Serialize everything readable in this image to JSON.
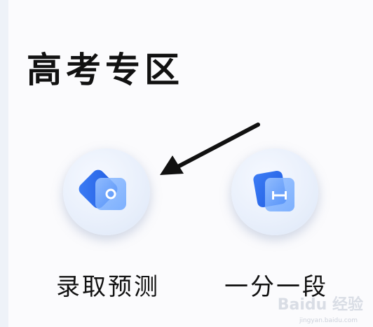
{
  "section": {
    "title": "高考专区"
  },
  "features": [
    {
      "label": "录取预测",
      "icon": "admission-prediction-icon"
    },
    {
      "label": "一分一段",
      "icon": "score-segment-icon"
    }
  ],
  "annotation": {
    "arrow": "arrow-pointing-left"
  },
  "watermark": {
    "text": "Baidu 经验",
    "sub": "jingyan.baidu.com"
  },
  "colors": {
    "accent_blue": "#2f6cf0",
    "accent_blue_light": "#5a9bff",
    "circle_bg": "#e8effb",
    "text": "#111111"
  }
}
